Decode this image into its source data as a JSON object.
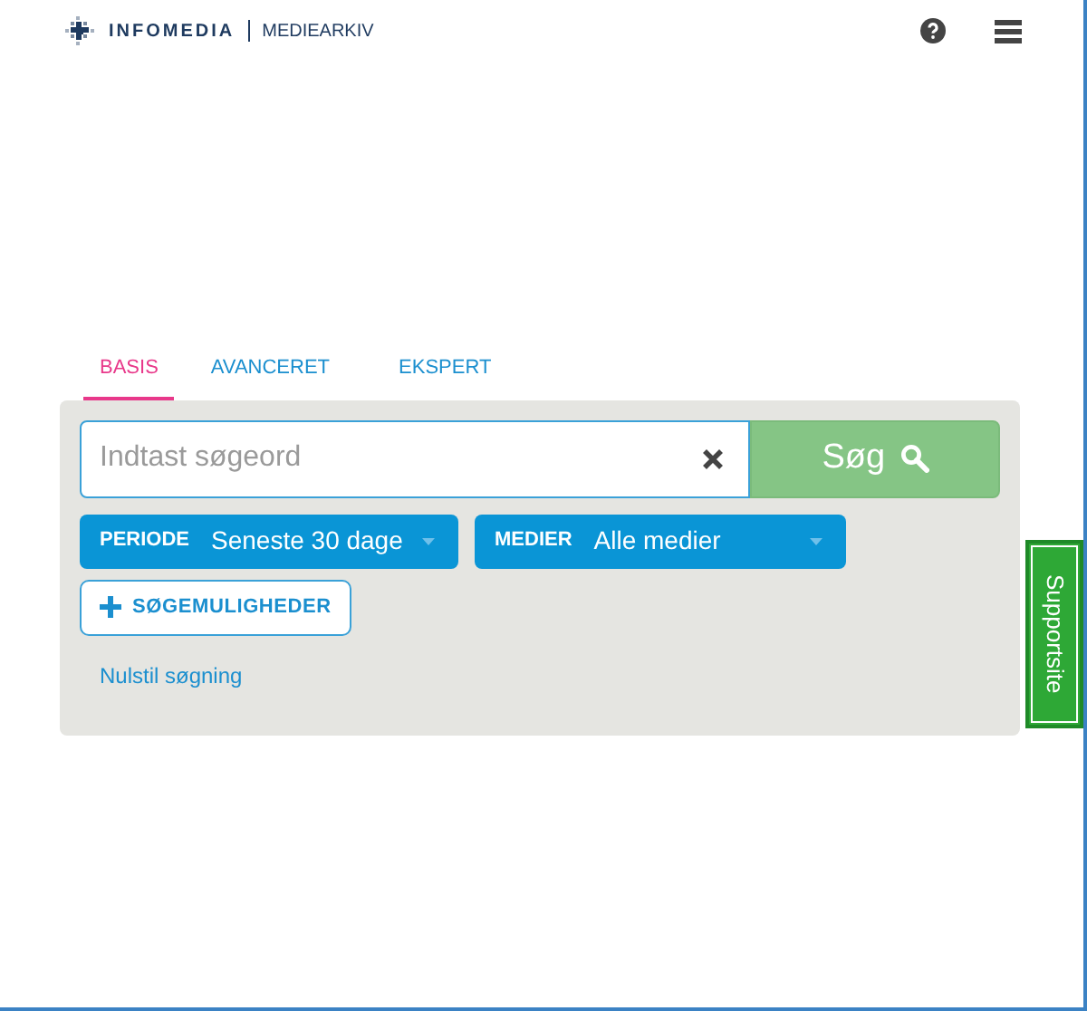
{
  "header": {
    "brand": "INFOMEDIA",
    "product": "MEDIEARKIV"
  },
  "tabs": [
    {
      "label": "BASIS",
      "selected": true
    },
    {
      "label": "AVANCERET",
      "selected": false
    },
    {
      "label": "EKSPERT",
      "selected": false
    }
  ],
  "search": {
    "placeholder": "Indtast søgeord",
    "button": "Søg"
  },
  "filters": [
    {
      "label": "PERIODE",
      "value": "Seneste 30 dage"
    },
    {
      "label": "MEDIER",
      "value": "Alle medier"
    }
  ],
  "options_button": "SØGEMULIGHEDER",
  "reset_link": "Nulstil søgning",
  "support_tab": "Supportsite"
}
